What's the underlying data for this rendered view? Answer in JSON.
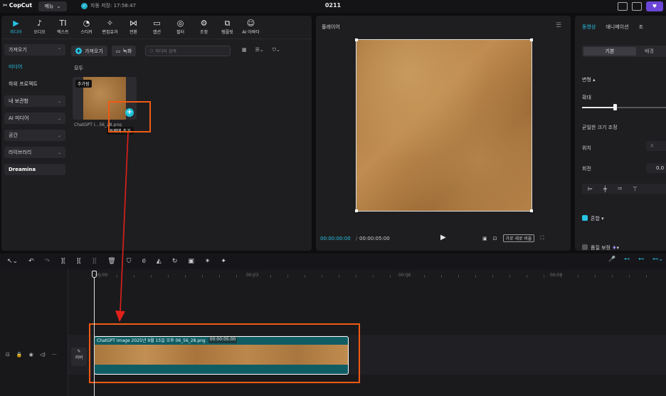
{
  "topbar": {
    "logo": "CopCut",
    "menu_label": "메뉴",
    "autosave": "자동 저장: 17:58:47",
    "project_name": "0211"
  },
  "tools": [
    {
      "label": "미디어",
      "glyph": "▶",
      "icon": "media-icon",
      "active": true
    },
    {
      "label": "오디오",
      "glyph": "♪",
      "icon": "audio-icon"
    },
    {
      "label": "텍스트",
      "glyph": "TI",
      "icon": "text-icon"
    },
    {
      "label": "스티커",
      "glyph": "◔",
      "icon": "sticker-icon"
    },
    {
      "label": "편집효과",
      "glyph": "✧",
      "icon": "effects-icon"
    },
    {
      "label": "전환",
      "glyph": "⋈",
      "icon": "transition-icon"
    },
    {
      "label": "캡션",
      "glyph": "▭",
      "icon": "caption-icon"
    },
    {
      "label": "필터",
      "glyph": "◎",
      "icon": "filter-icon"
    },
    {
      "label": "조정",
      "glyph": "⚙",
      "icon": "adjust-icon"
    },
    {
      "label": "템플릿",
      "glyph": "⧉",
      "icon": "template-icon"
    },
    {
      "label": "AI 아바타",
      "glyph": "☺",
      "icon": "ai-avatar-icon"
    }
  ],
  "sidebar": {
    "items": [
      {
        "label": "가져오기",
        "chev": "⌃",
        "style": "box"
      },
      {
        "label": "미디어",
        "chev": "",
        "style": "active-sub"
      },
      {
        "label": "하위 프로젝트",
        "chev": "",
        "style": "plain"
      },
      {
        "label": "내 보관함",
        "chev": "⌄",
        "style": "box"
      },
      {
        "label": "AI 미디어",
        "chev": "⌄",
        "style": "box"
      },
      {
        "label": "공간",
        "chev": "⌄",
        "style": "box"
      },
      {
        "label": "라이브러리",
        "chev": "⌄",
        "style": "box"
      },
      {
        "label": "Dreamina",
        "chev": "",
        "style": "box-bold"
      }
    ]
  },
  "media": {
    "import_label": "가져오기",
    "record_label": "녹화",
    "search_placeholder": "미디어 검색",
    "all_label": "모두",
    "added_tag": "추가됨",
    "thumb_name": "ChatGPT I...56_28.png",
    "tooltip": "트랙에 추가"
  },
  "player": {
    "title": "플레이어",
    "time_current": "00:00:00:00",
    "time_total": "00:00:05:00",
    "ratio_label": "가로 세로 비율"
  },
  "props": {
    "tabs": [
      "동영상",
      "애니메이션",
      "조"
    ],
    "seg_on": "기본",
    "seg_off": "배경",
    "transform_label": "변형",
    "scale_label": "확대",
    "scale_fraction": 0.39,
    "uniform_scale_label": "균일한 크기 조정",
    "position_label": "위치",
    "position_x": "X",
    "rotation_label": "회전",
    "rotation_value": "0.0",
    "blend_label": "혼합",
    "quality_label": "품질 보정"
  },
  "timeline": {
    "tick_labels": [
      "00:00",
      "00:03",
      "00:06",
      "00:09"
    ],
    "cover_label": "커버",
    "clip_name": "ChatGPT Image 2025년 9월 15일 오후 06_56_28.png",
    "clip_duration": "00:00:05:00"
  },
  "colors": {
    "accent": "#27c3e3",
    "highlight": "#ef5a12",
    "arrow": "#e0201a",
    "clip": "#0f5d63"
  }
}
